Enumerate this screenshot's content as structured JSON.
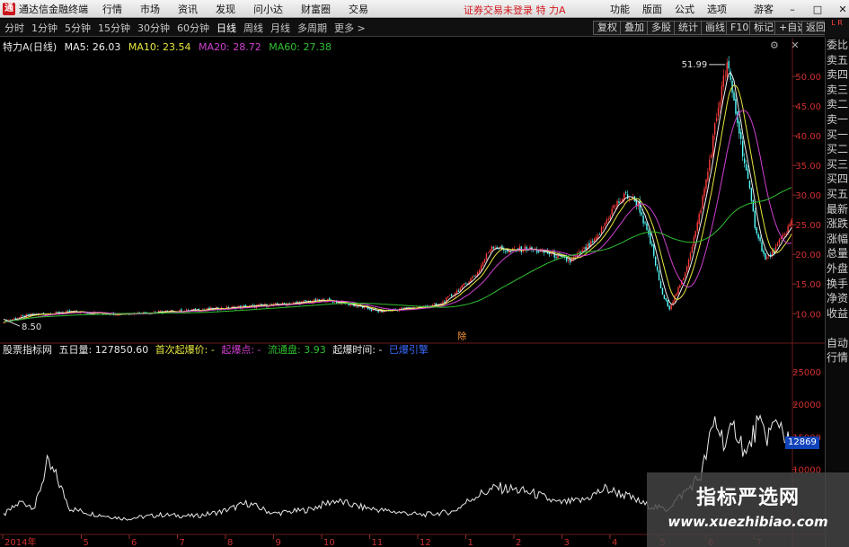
{
  "app": {
    "title": "通达信金融终端",
    "logo": "通"
  },
  "menu": [
    "行情",
    "市场",
    "资讯",
    "发现",
    "问小达",
    "财富圈",
    "交易"
  ],
  "status_text": "证券交易未登录  特 力A",
  "right_menu": [
    "功能",
    "版面",
    "公式",
    "选项",
    "游客"
  ],
  "periods": [
    "分时",
    "1分钟",
    "5分钟",
    "15分钟",
    "30分钟",
    "60分钟",
    "日线",
    "周线",
    "月线",
    "多周期",
    "更多 >"
  ],
  "active_period": "日线",
  "toolbar": [
    "复权",
    "叠加",
    "多股",
    "统计",
    "画线",
    "F10",
    "标记",
    "+自选",
    "返回"
  ],
  "side_top": "L R",
  "side_panel": [
    "委比",
    "卖五",
    "卖四",
    "卖三",
    "卖二",
    "卖一",
    "买一",
    "买二",
    "买三",
    "买四",
    "买五",
    "最新",
    "涨跌",
    "涨幅",
    "总量",
    "外盘",
    "换手",
    "净资",
    "收益",
    "",
    "自动",
    "行情"
  ],
  "main_info": {
    "name": "特力A(日线)",
    "ma5": "MA5: 26.03",
    "ma10": "MA10: 23.54",
    "ma20": "MA20: 28.72",
    "ma60": "MA60: 27.38"
  },
  "indicator_info": {
    "name": "股票指标网",
    "volume": "五日量: 127850.60",
    "first_launch": "首次起爆价: -",
    "launch_point": "起爆点: -",
    "float_share": "流通盘: 3.93",
    "launch_time": "起爆时间: -",
    "launched": "已爆引擎"
  },
  "colors": {
    "ma5": "#f0f0f0",
    "ma10": "#e8e840",
    "ma20": "#d040d0",
    "ma60": "#30c030",
    "up": "#ff3b3b",
    "down": "#54ffff",
    "grid": "#5a1515"
  },
  "marker_text": "除",
  "current_value": "12869",
  "watermark": {
    "title": "指标严选网",
    "url": "www.xuezhibiao.com"
  },
  "chart_data": [
    {
      "type": "candlestick",
      "title": "特力A(日线)",
      "y_ticks": [
        10.0,
        15.0,
        20.0,
        25.0,
        30.0,
        35.0,
        40.0,
        45.0,
        50.0
      ],
      "ylim": [
        5.5,
        55
      ],
      "x_ticks": [
        "2014年",
        "5",
        "6",
        "7",
        "8",
        "9",
        "10",
        "11",
        "12",
        "1",
        "2",
        "3",
        "4",
        "5",
        "6",
        "7"
      ],
      "annotations": [
        {
          "label": "8.50",
          "at": "low"
        },
        {
          "label": "51.99",
          "at": "high"
        }
      ],
      "price_keypoints": [
        [
          0,
          8.7
        ],
        [
          15,
          9.8
        ],
        [
          40,
          10.3
        ],
        [
          65,
          10.0
        ],
        [
          100,
          10.4
        ],
        [
          130,
          11.0
        ],
        [
          160,
          11.6
        ],
        [
          185,
          12.3
        ],
        [
          200,
          11.5
        ],
        [
          215,
          10.4
        ],
        [
          235,
          11.0
        ],
        [
          250,
          11.5
        ],
        [
          263,
          14.5
        ],
        [
          272,
          17.0
        ],
        [
          280,
          21.5
        ],
        [
          290,
          20.5
        ],
        [
          300,
          21.0
        ],
        [
          315,
          20.0
        ],
        [
          325,
          18.8
        ],
        [
          340,
          22.5
        ],
        [
          350,
          28.0
        ],
        [
          357,
          30.0
        ],
        [
          364,
          28.5
        ],
        [
          372,
          21.0
        ],
        [
          378,
          13.0
        ],
        [
          382,
          11.0
        ],
        [
          390,
          16.0
        ],
        [
          398,
          25.0
        ],
        [
          404,
          34.0
        ],
        [
          410,
          45.0
        ],
        [
          415,
          51.99
        ],
        [
          420,
          44.0
        ],
        [
          426,
          34.0
        ],
        [
          431,
          25.0
        ],
        [
          437,
          19.0
        ],
        [
          443,
          21.0
        ],
        [
          449,
          24.0
        ],
        [
          452,
          25.5
        ]
      ]
    },
    {
      "type": "line",
      "title": "股票指标网",
      "y_ticks": [
        10000,
        15000,
        20000,
        25000
      ],
      "ylim": [
        0,
        28000
      ],
      "volume_keypoints": [
        [
          0,
          3000
        ],
        [
          10,
          5000
        ],
        [
          18,
          4200
        ],
        [
          25,
          10800
        ],
        [
          30,
          9000
        ],
        [
          38,
          4000
        ],
        [
          50,
          3200
        ],
        [
          70,
          2400
        ],
        [
          90,
          3000
        ],
        [
          110,
          2800
        ],
        [
          125,
          3500
        ],
        [
          140,
          4800
        ],
        [
          155,
          3200
        ],
        [
          175,
          3800
        ],
        [
          190,
          5200
        ],
        [
          205,
          4200
        ],
        [
          220,
          3600
        ],
        [
          240,
          3000
        ],
        [
          258,
          3500
        ],
        [
          270,
          5800
        ],
        [
          283,
          7200
        ],
        [
          295,
          6800
        ],
        [
          305,
          6200
        ],
        [
          318,
          4800
        ],
        [
          332,
          5200
        ],
        [
          345,
          7000
        ],
        [
          355,
          6200
        ],
        [
          368,
          4600
        ],
        [
          380,
          3800
        ],
        [
          392,
          6800
        ],
        [
          400,
          9000
        ],
        [
          408,
          17500
        ],
        [
          414,
          14000
        ],
        [
          420,
          16500
        ],
        [
          426,
          12000
        ],
        [
          432,
          16800
        ],
        [
          438,
          15200
        ],
        [
          445,
          17500
        ],
        [
          452,
          12869
        ]
      ]
    }
  ]
}
